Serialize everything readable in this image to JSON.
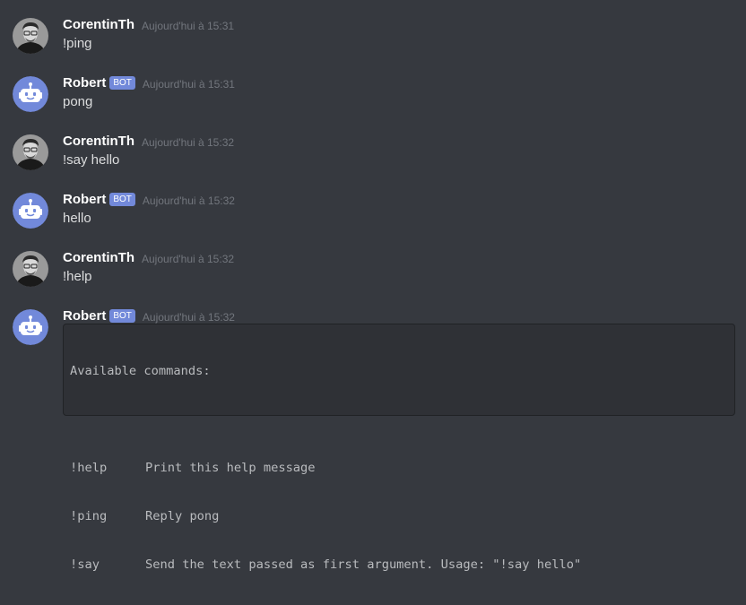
{
  "colors": {
    "background": "#36393f",
    "username": "#ffffff",
    "text": "#dcddde",
    "timestamp": "#72767d",
    "bot_tag": "#7289da",
    "code_background": "#2f3136"
  },
  "messages": [
    {
      "author": "CorentinTh",
      "avatar": "user-photo-avatar",
      "timestamp": "Aujourd'hui à 15:31",
      "content": "!ping"
    },
    {
      "author": "Robert",
      "avatar": "robot-avatar-icon",
      "bot_tag": "BOT",
      "timestamp": "Aujourd'hui à 15:31",
      "content": "pong"
    },
    {
      "author": "CorentinTh",
      "avatar": "user-photo-avatar",
      "timestamp": "Aujourd'hui à 15:32",
      "content": "!say hello"
    },
    {
      "author": "Robert",
      "avatar": "robot-avatar-icon",
      "bot_tag": "BOT",
      "timestamp": "Aujourd'hui à 15:32",
      "content": "hello"
    },
    {
      "author": "CorentinTh",
      "avatar": "user-photo-avatar",
      "timestamp": "Aujourd'hui à 15:32",
      "content": "!help"
    },
    {
      "author": "Robert",
      "avatar": "robot-avatar-icon",
      "bot_tag": "BOT",
      "timestamp": "Aujourd'hui à 15:32",
      "code_block": {
        "heading": "Available commands:",
        "commands": [
          {
            "name": "!help",
            "description": "Print this help message"
          },
          {
            "name": "!ping",
            "description": "Reply pong"
          },
          {
            "name": "!say",
            "description": "Send the text passed as first argument. Usage: \"!say hello\""
          }
        ]
      }
    }
  ]
}
